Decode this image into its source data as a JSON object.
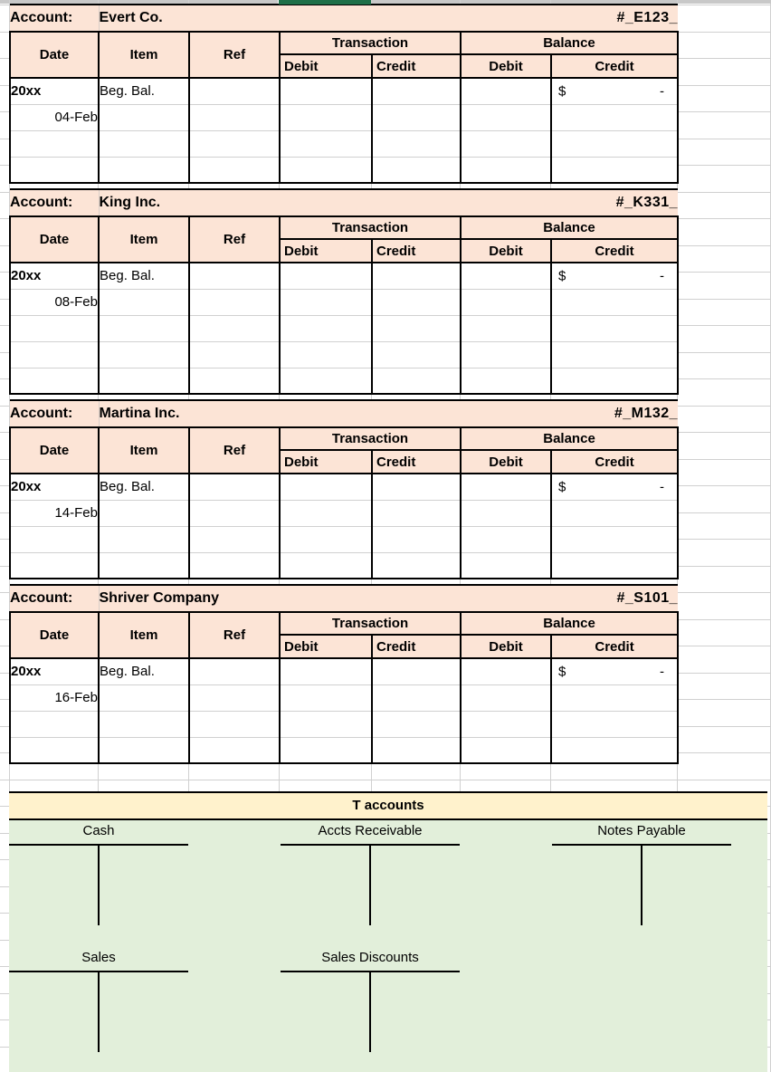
{
  "spreadsheet": {
    "selected_column_marker": "column-d-selected",
    "accent_green": "#1e6f48",
    "header_fill": "#fce4d6",
    "t_title_fill": "#fff2cc",
    "t_body_fill": "#e2efda"
  },
  "ledger_headers": {
    "account_label": "Account:",
    "date": "Date",
    "item": "Item",
    "ref": "Ref",
    "transaction": "Transaction",
    "balance": "Balance",
    "debit": "Debit",
    "credit": "Credit"
  },
  "ledgers": [
    {
      "account_name": "Evert Co.",
      "account_number": "#_E123_",
      "rows": [
        {
          "date_year": "20xx",
          "item": "Beg. Bal.",
          "ref": "",
          "txn_debit": "",
          "txn_credit": "",
          "bal_debit": "",
          "bal_credit_currency": "$",
          "bal_credit_amount": "-"
        },
        {
          "date_day": "04-Feb",
          "item": "",
          "ref": "",
          "txn_debit": "",
          "txn_credit": "",
          "bal_debit": "",
          "bal_credit_currency": "",
          "bal_credit_amount": ""
        },
        {
          "date_day": "",
          "item": "",
          "ref": "",
          "txn_debit": "",
          "txn_credit": "",
          "bal_debit": "",
          "bal_credit_currency": "",
          "bal_credit_amount": ""
        },
        {
          "date_day": "",
          "item": "",
          "ref": "",
          "txn_debit": "",
          "txn_credit": "",
          "bal_debit": "",
          "bal_credit_currency": "",
          "bal_credit_amount": ""
        }
      ]
    },
    {
      "account_name": "King Inc.",
      "account_number": "#_K331_",
      "rows": [
        {
          "date_year": "20xx",
          "item": "Beg. Bal.",
          "ref": "",
          "txn_debit": "",
          "txn_credit": "",
          "bal_debit": "",
          "bal_credit_currency": "$",
          "bal_credit_amount": "-"
        },
        {
          "date_day": "08-Feb",
          "item": "",
          "ref": "",
          "txn_debit": "",
          "txn_credit": "",
          "bal_debit": "",
          "bal_credit_currency": "",
          "bal_credit_amount": ""
        },
        {
          "date_day": "",
          "item": "",
          "ref": "",
          "txn_debit": "",
          "txn_credit": "",
          "bal_debit": "",
          "bal_credit_currency": "",
          "bal_credit_amount": ""
        },
        {
          "date_day": "",
          "item": "",
          "ref": "",
          "txn_debit": "",
          "txn_credit": "",
          "bal_debit": "",
          "bal_credit_currency": "",
          "bal_credit_amount": ""
        },
        {
          "date_day": "",
          "item": "",
          "ref": "",
          "txn_debit": "",
          "txn_credit": "",
          "bal_debit": "",
          "bal_credit_currency": "",
          "bal_credit_amount": ""
        }
      ]
    },
    {
      "account_name": "Martina Inc.",
      "account_number": "#_M132_",
      "rows": [
        {
          "date_year": "20xx",
          "item": "Beg. Bal.",
          "ref": "",
          "txn_debit": "",
          "txn_credit": "",
          "bal_debit": "",
          "bal_credit_currency": "$",
          "bal_credit_amount": "-"
        },
        {
          "date_day": "14-Feb",
          "item": "",
          "ref": "",
          "txn_debit": "",
          "txn_credit": "",
          "bal_debit": "",
          "bal_credit_currency": "",
          "bal_credit_amount": ""
        },
        {
          "date_day": "",
          "item": "",
          "ref": "",
          "txn_debit": "",
          "txn_credit": "",
          "bal_debit": "",
          "bal_credit_currency": "",
          "bal_credit_amount": ""
        },
        {
          "date_day": "",
          "item": "",
          "ref": "",
          "txn_debit": "",
          "txn_credit": "",
          "bal_debit": "",
          "bal_credit_currency": "",
          "bal_credit_amount": ""
        }
      ]
    },
    {
      "account_name": "Shriver Company",
      "account_number": "#_S101_",
      "rows": [
        {
          "date_year": "20xx",
          "item": "Beg. Bal.",
          "ref": "",
          "txn_debit": "",
          "txn_credit": "",
          "bal_debit": "",
          "bal_credit_currency": "$",
          "bal_credit_amount": "-"
        },
        {
          "date_day": "16-Feb",
          "item": "",
          "ref": "",
          "txn_debit": "",
          "txn_credit": "",
          "bal_debit": "",
          "bal_credit_currency": "",
          "bal_credit_amount": ""
        },
        {
          "date_day": "",
          "item": "",
          "ref": "",
          "txn_debit": "",
          "txn_credit": "",
          "bal_debit": "",
          "bal_credit_currency": "",
          "bal_credit_amount": ""
        },
        {
          "date_day": "",
          "item": "",
          "ref": "",
          "txn_debit": "",
          "txn_credit": "",
          "bal_debit": "",
          "bal_credit_currency": "",
          "bal_credit_amount": ""
        }
      ]
    }
  ],
  "t_accounts": {
    "title": "T accounts",
    "rows": [
      [
        {
          "name": "Cash"
        },
        {
          "name": "Accts Receivable"
        },
        {
          "name": "Notes Payable"
        }
      ],
      [
        {
          "name": "Sales"
        },
        {
          "name": "Sales Discounts"
        },
        {
          "name": ""
        }
      ]
    ]
  }
}
